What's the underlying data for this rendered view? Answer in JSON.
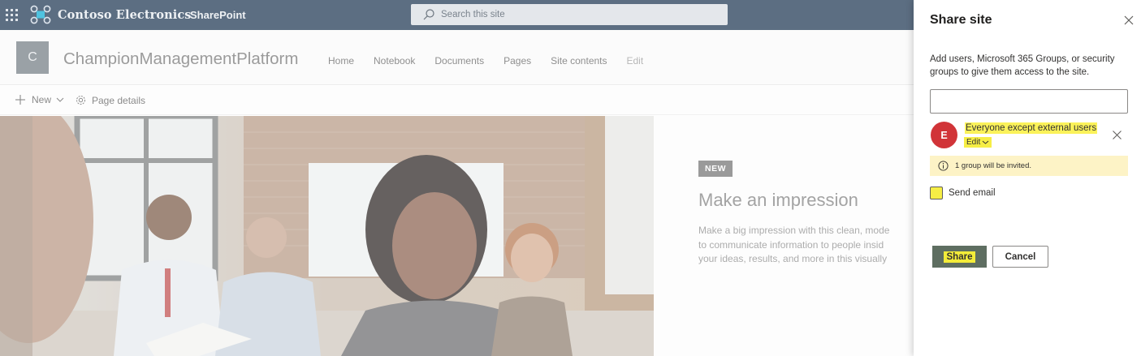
{
  "suite_bar": {
    "brand": "Contoso Electronics",
    "app_name": "SharePoint",
    "search_placeholder": "Search this site",
    "waffle_icon": "app-launcher-icon",
    "logo_icon": "contoso-logo-icon"
  },
  "site_header": {
    "logo_letter": "C",
    "title": "ChampionManagementPlatform",
    "nav": [
      {
        "label": "Home"
      },
      {
        "label": "Notebook"
      },
      {
        "label": "Documents"
      },
      {
        "label": "Pages"
      },
      {
        "label": "Site contents"
      },
      {
        "label": "Edit"
      }
    ]
  },
  "command_bar": {
    "new_label": "New",
    "page_details_label": "Page details"
  },
  "hero": {
    "badge": "NEW",
    "title": "Make an impression",
    "body_lines": [
      "Make a big impression with this clean, mode",
      "to communicate information to people insid",
      "your ideas, results, and more in this visually"
    ]
  },
  "share_panel": {
    "title": "Share site",
    "description": "Add users, Microsoft 365 Groups, or security groups to give them access to the site.",
    "input_value": "",
    "group": {
      "initial": "E",
      "name": "Everyone except external users",
      "role": "Edit",
      "avatar_color": "#d13438"
    },
    "info_message": "1 group will be invited.",
    "send_email_label": "Send email",
    "send_email_checked": false,
    "share_label": "Share",
    "cancel_label": "Cancel"
  },
  "colors": {
    "suite_bar": "#5c6e82",
    "highlight": "#f6ee45",
    "info_bar": "#fdf3c6"
  }
}
